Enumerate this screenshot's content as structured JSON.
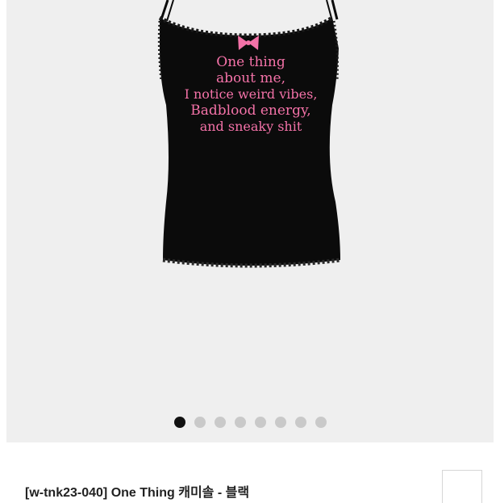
{
  "gallery": {
    "shirt_text_lines": [
      "One thing",
      "about me,",
      "I notice weird vibes,",
      "Badblood energy,",
      "and sneaky shit"
    ],
    "dot_count": 8,
    "active_dot_index": 0,
    "background_color": "#efefef",
    "garment_color": "#0b0b0b",
    "print_color": "#f472a8"
  },
  "product": {
    "title": "[w-tnk23-040] One Thing 캐미솔 - 블랙"
  }
}
